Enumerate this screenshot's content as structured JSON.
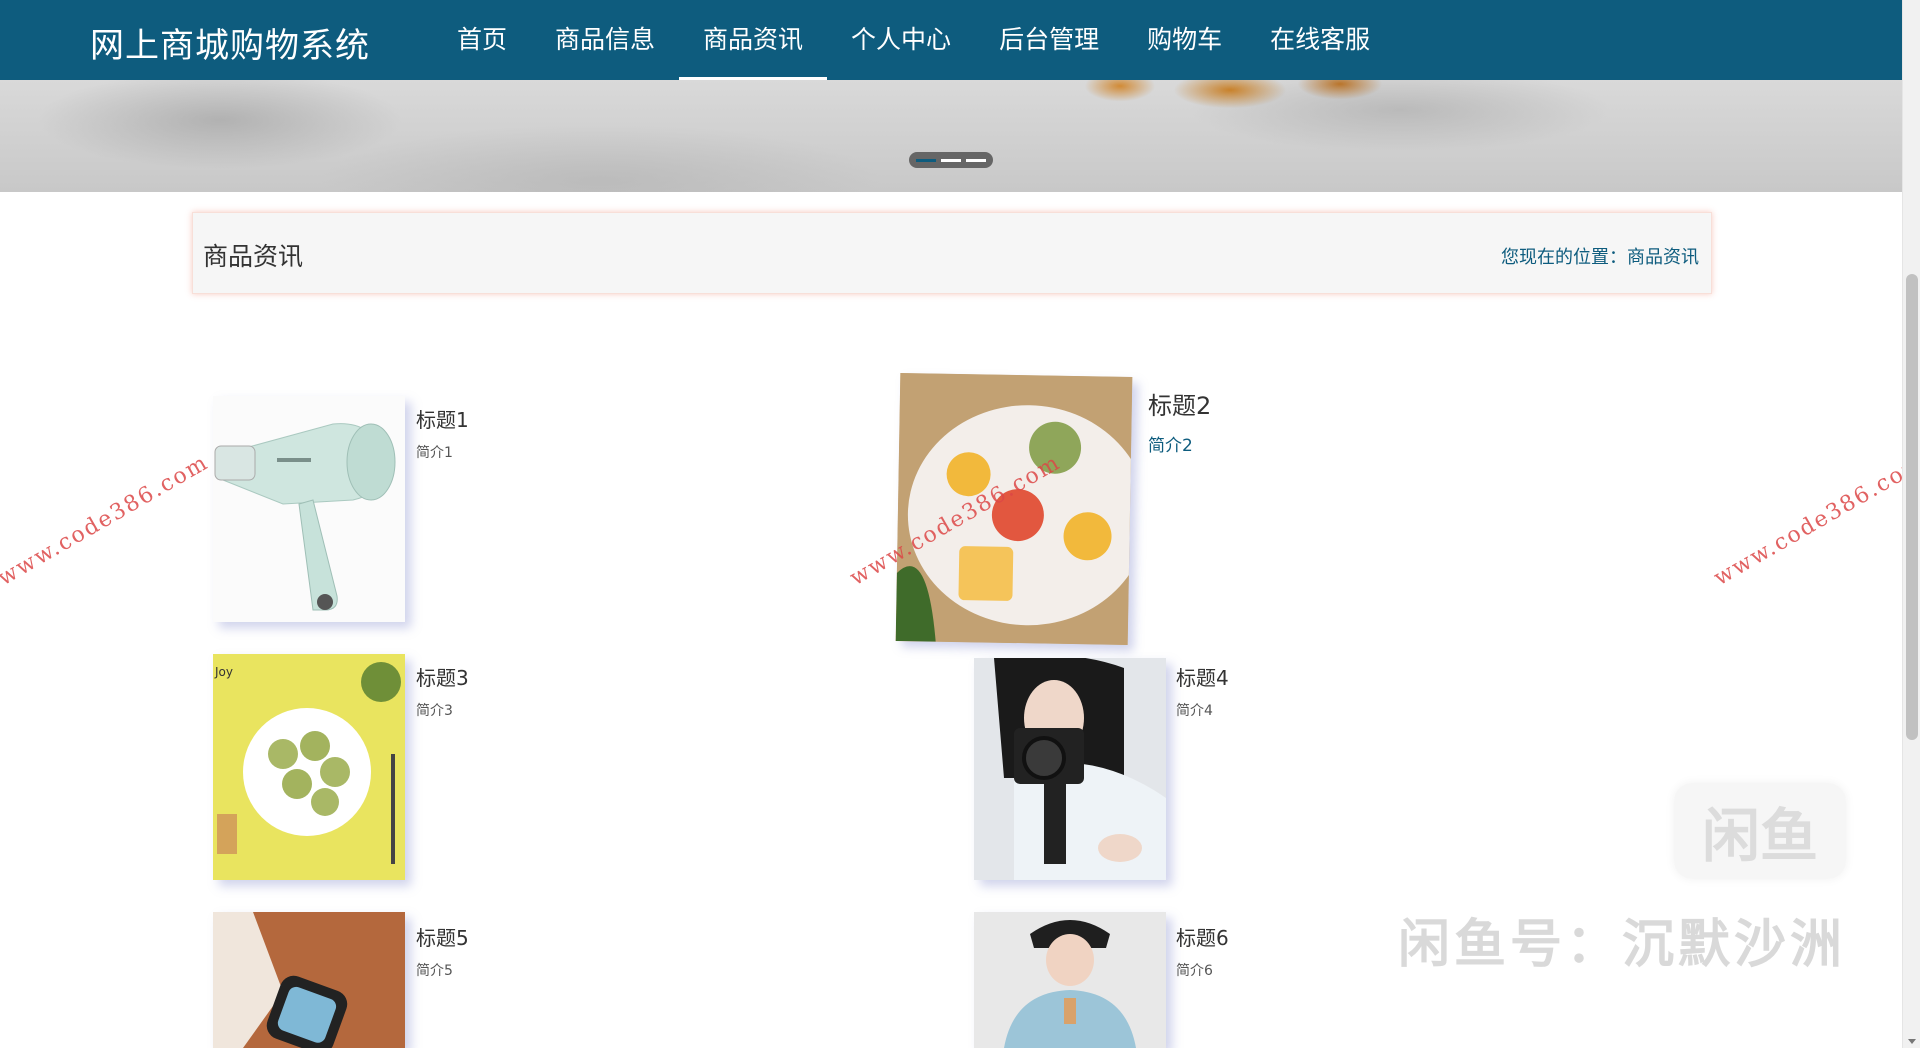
{
  "header": {
    "brand": "网上商城购物系统",
    "nav": [
      {
        "label": "首页",
        "active": false
      },
      {
        "label": "商品信息",
        "active": false
      },
      {
        "label": "商品资讯",
        "active": true
      },
      {
        "label": "个人中心",
        "active": false
      },
      {
        "label": "后台管理",
        "active": false
      },
      {
        "label": "购物车",
        "active": false
      },
      {
        "label": "在线客服",
        "active": false
      }
    ],
    "accent_color": "#0e5c7e"
  },
  "banner": {
    "slides_total": 3,
    "active_slide": 1
  },
  "breadcrumb": {
    "title": "商品资讯",
    "location": "您现在的位置：商品资讯"
  },
  "news": [
    {
      "title": "标题1",
      "summary": "简介1",
      "image": "hair-dryer-image"
    },
    {
      "title": "标题2",
      "summary": "简介2",
      "image": "mooncake-plate-image"
    },
    {
      "title": "标题3",
      "summary": "简介3",
      "image": "matcha-cookies-image"
    },
    {
      "title": "标题4",
      "summary": "简介4",
      "image": "camera-vlog-image"
    },
    {
      "title": "标题5",
      "summary": "简介5",
      "image": "smartwatch-image"
    },
    {
      "title": "标题6",
      "summary": "简介6",
      "image": "hoodie-model-image"
    }
  ],
  "watermarks": {
    "site": "www.code386.com",
    "logo": "闲鱼",
    "account": "闲鱼号：沉默沙洲"
  }
}
